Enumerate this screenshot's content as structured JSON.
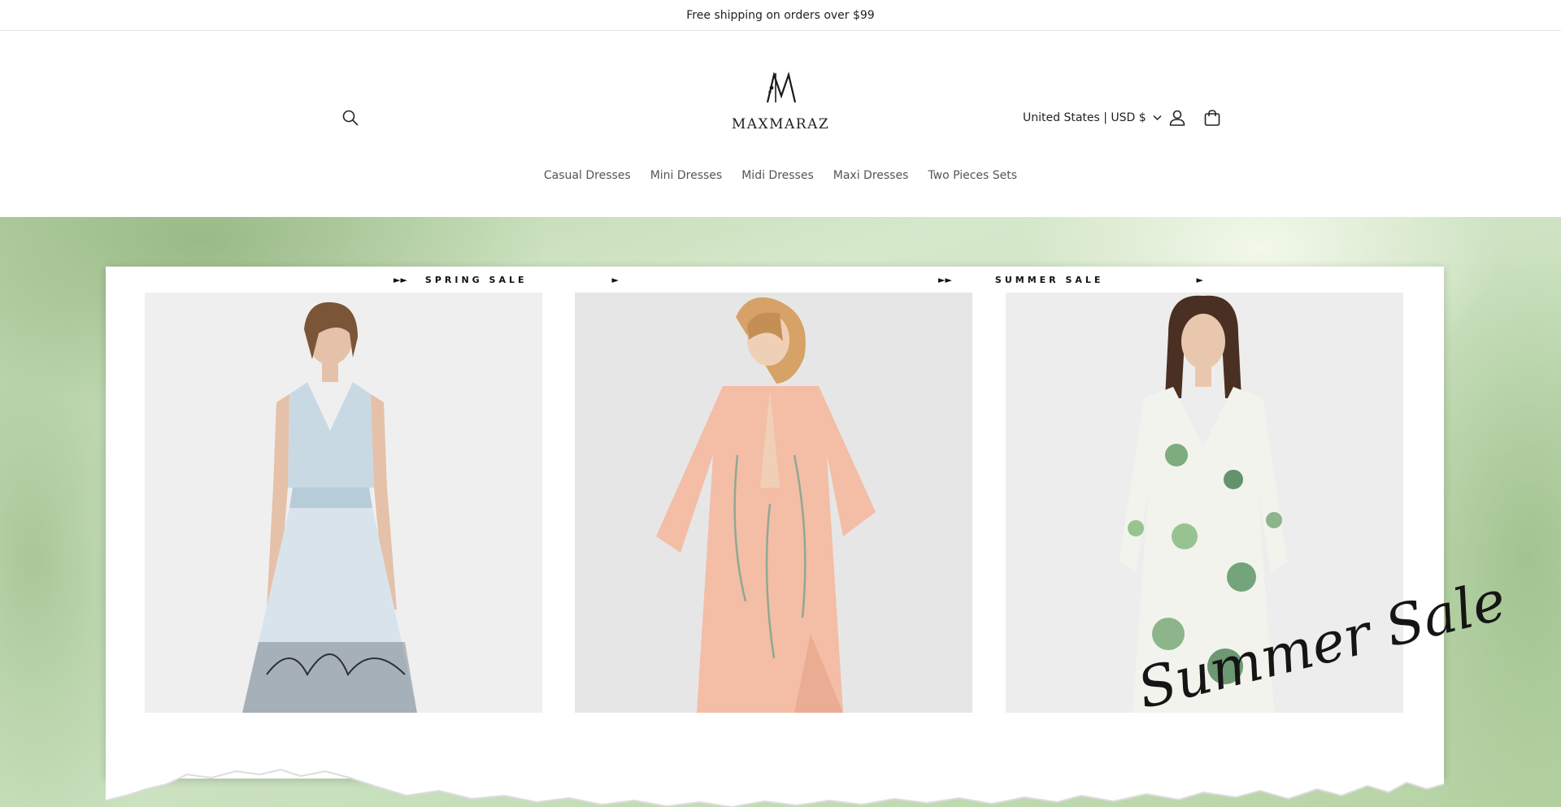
{
  "announcement": {
    "text": "Free shipping on orders over $99"
  },
  "header": {
    "logo_text": "MAXMARAZ",
    "search_icon": "search-icon",
    "account_icon": "user-icon",
    "cart_icon": "cart-icon",
    "country_selector": {
      "label": "United States | USD $",
      "icon": "chevron-down-icon"
    }
  },
  "nav": {
    "items": [
      {
        "label": "Casual Dresses"
      },
      {
        "label": "Mini Dresses"
      },
      {
        "label": "Midi Dresses"
      },
      {
        "label": "Maxi Dresses"
      },
      {
        "label": "Two Pieces Sets"
      }
    ]
  },
  "hero": {
    "spring_label": "SPRING SALE",
    "summer_label": "SUMMER SALE",
    "arrows_double": "►►",
    "arrow_single": "►",
    "script_text": "Summer Sale",
    "colors": {
      "background": "#c9e0bd",
      "paper": "#ffffff"
    }
  }
}
